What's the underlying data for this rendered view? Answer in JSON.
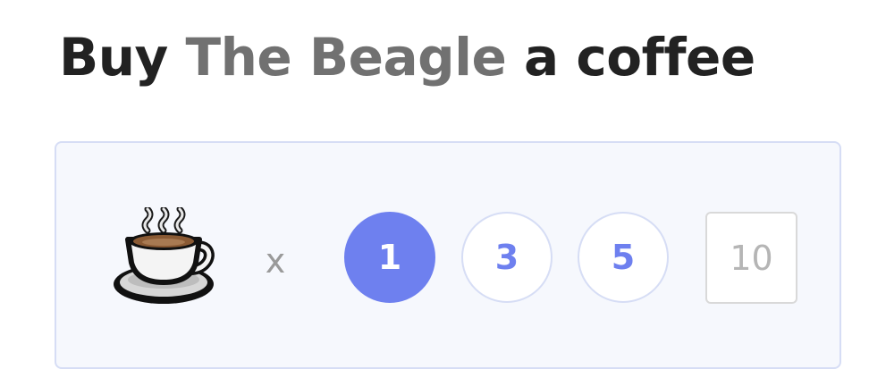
{
  "header": {
    "prefix": "Buy",
    "creator_name": "The Beagle",
    "suffix": "a coffee"
  },
  "support_panel": {
    "icon": "coffee-cup-icon",
    "multiplier_symbol": "x",
    "quantity_options": [
      "1",
      "3",
      "5"
    ],
    "selected_quantity": "1",
    "custom_quantity_placeholder": "10",
    "accent_color": "#6e80ef",
    "panel_background": "#f6f8fd",
    "panel_border": "#d6ddf5"
  }
}
